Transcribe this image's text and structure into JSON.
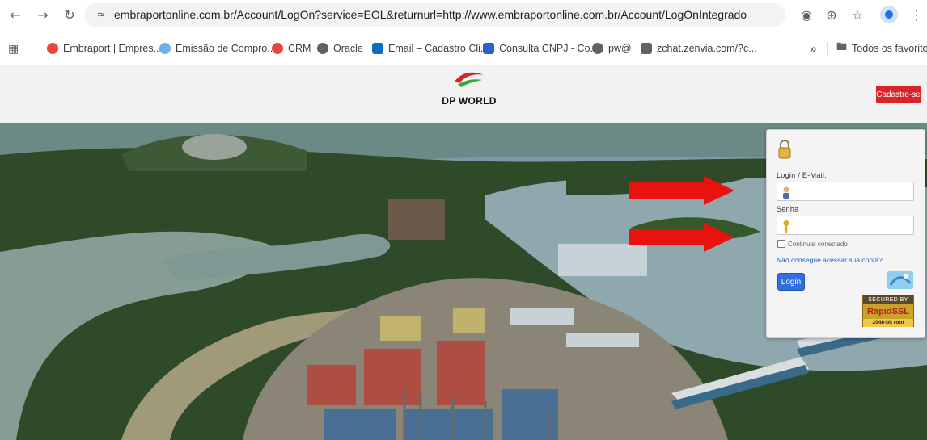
{
  "browser": {
    "url": "embraportonline.com.br/Account/LogOn?service=EOL&returnurl=http://www.embraportonline.com.br/Account/LogOnIntegrado",
    "bookmarks": [
      {
        "label": "Embraport | Empres...",
        "color": "#e8453c"
      },
      {
        "label": "Emissão de Compro...",
        "color": "#6fb1e8"
      },
      {
        "label": "CRM",
        "color": "#e8453c"
      },
      {
        "label": "Oracle",
        "color": "#5f6368"
      },
      {
        "label": "Email – Cadastro Cli...",
        "color": "#0f6cbd"
      },
      {
        "label": "Consulta CNPJ - Co...",
        "color": "#2b62c9"
      },
      {
        "label": "pw@",
        "color": "#5f6368"
      },
      {
        "label": "zchat.zenvia.com/?c...",
        "color": "#5f6368"
      }
    ],
    "overflow_label": "»",
    "all_bookmarks_label": "Todos os favoritos"
  },
  "header": {
    "logo_text": "DP WORLD",
    "signup_label": "Cadastre-se",
    "brand_colors": {
      "red": "#d9252a",
      "green": "#39a935"
    }
  },
  "login": {
    "user_label": "Login / E-Mail:",
    "password_label": "Senha",
    "remember_label": "Continuar conectado",
    "forgot_label": "Não consegue acessar sua conta?",
    "button_label": "Login",
    "ssl_top": "SECURED BY",
    "ssl_brand": "RapidSSL",
    "ssl_bottom": "2048-bit root"
  }
}
